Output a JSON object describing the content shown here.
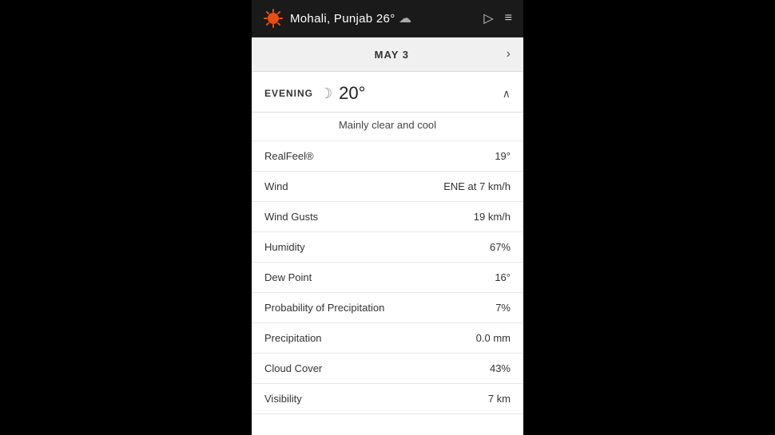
{
  "header": {
    "location": "Mohali, Punjab",
    "temperature": "26°",
    "play_icon": "▷",
    "menu_icon": "≡"
  },
  "date_bar": {
    "label": "MAY 3",
    "chevron": "›"
  },
  "evening": {
    "label": "EVENING",
    "moon_icon": "☽",
    "temperature": "20°",
    "description": "Mainly clear and cool",
    "collapse_icon": "∧"
  },
  "weather_data": [
    {
      "label": "RealFeel®",
      "value": "19°"
    },
    {
      "label": "Wind",
      "value": "ENE at 7 km/h"
    },
    {
      "label": "Wind Gusts",
      "value": "19 km/h"
    },
    {
      "label": "Humidity",
      "value": "67%"
    },
    {
      "label": "Dew Point",
      "value": "16°"
    },
    {
      "label": "Probability of Precipitation",
      "value": "7%"
    },
    {
      "label": "Precipitation",
      "value": "0.0 mm"
    },
    {
      "label": "Cloud Cover",
      "value": "43%"
    },
    {
      "label": "Visibility",
      "value": "7 km"
    }
  ]
}
